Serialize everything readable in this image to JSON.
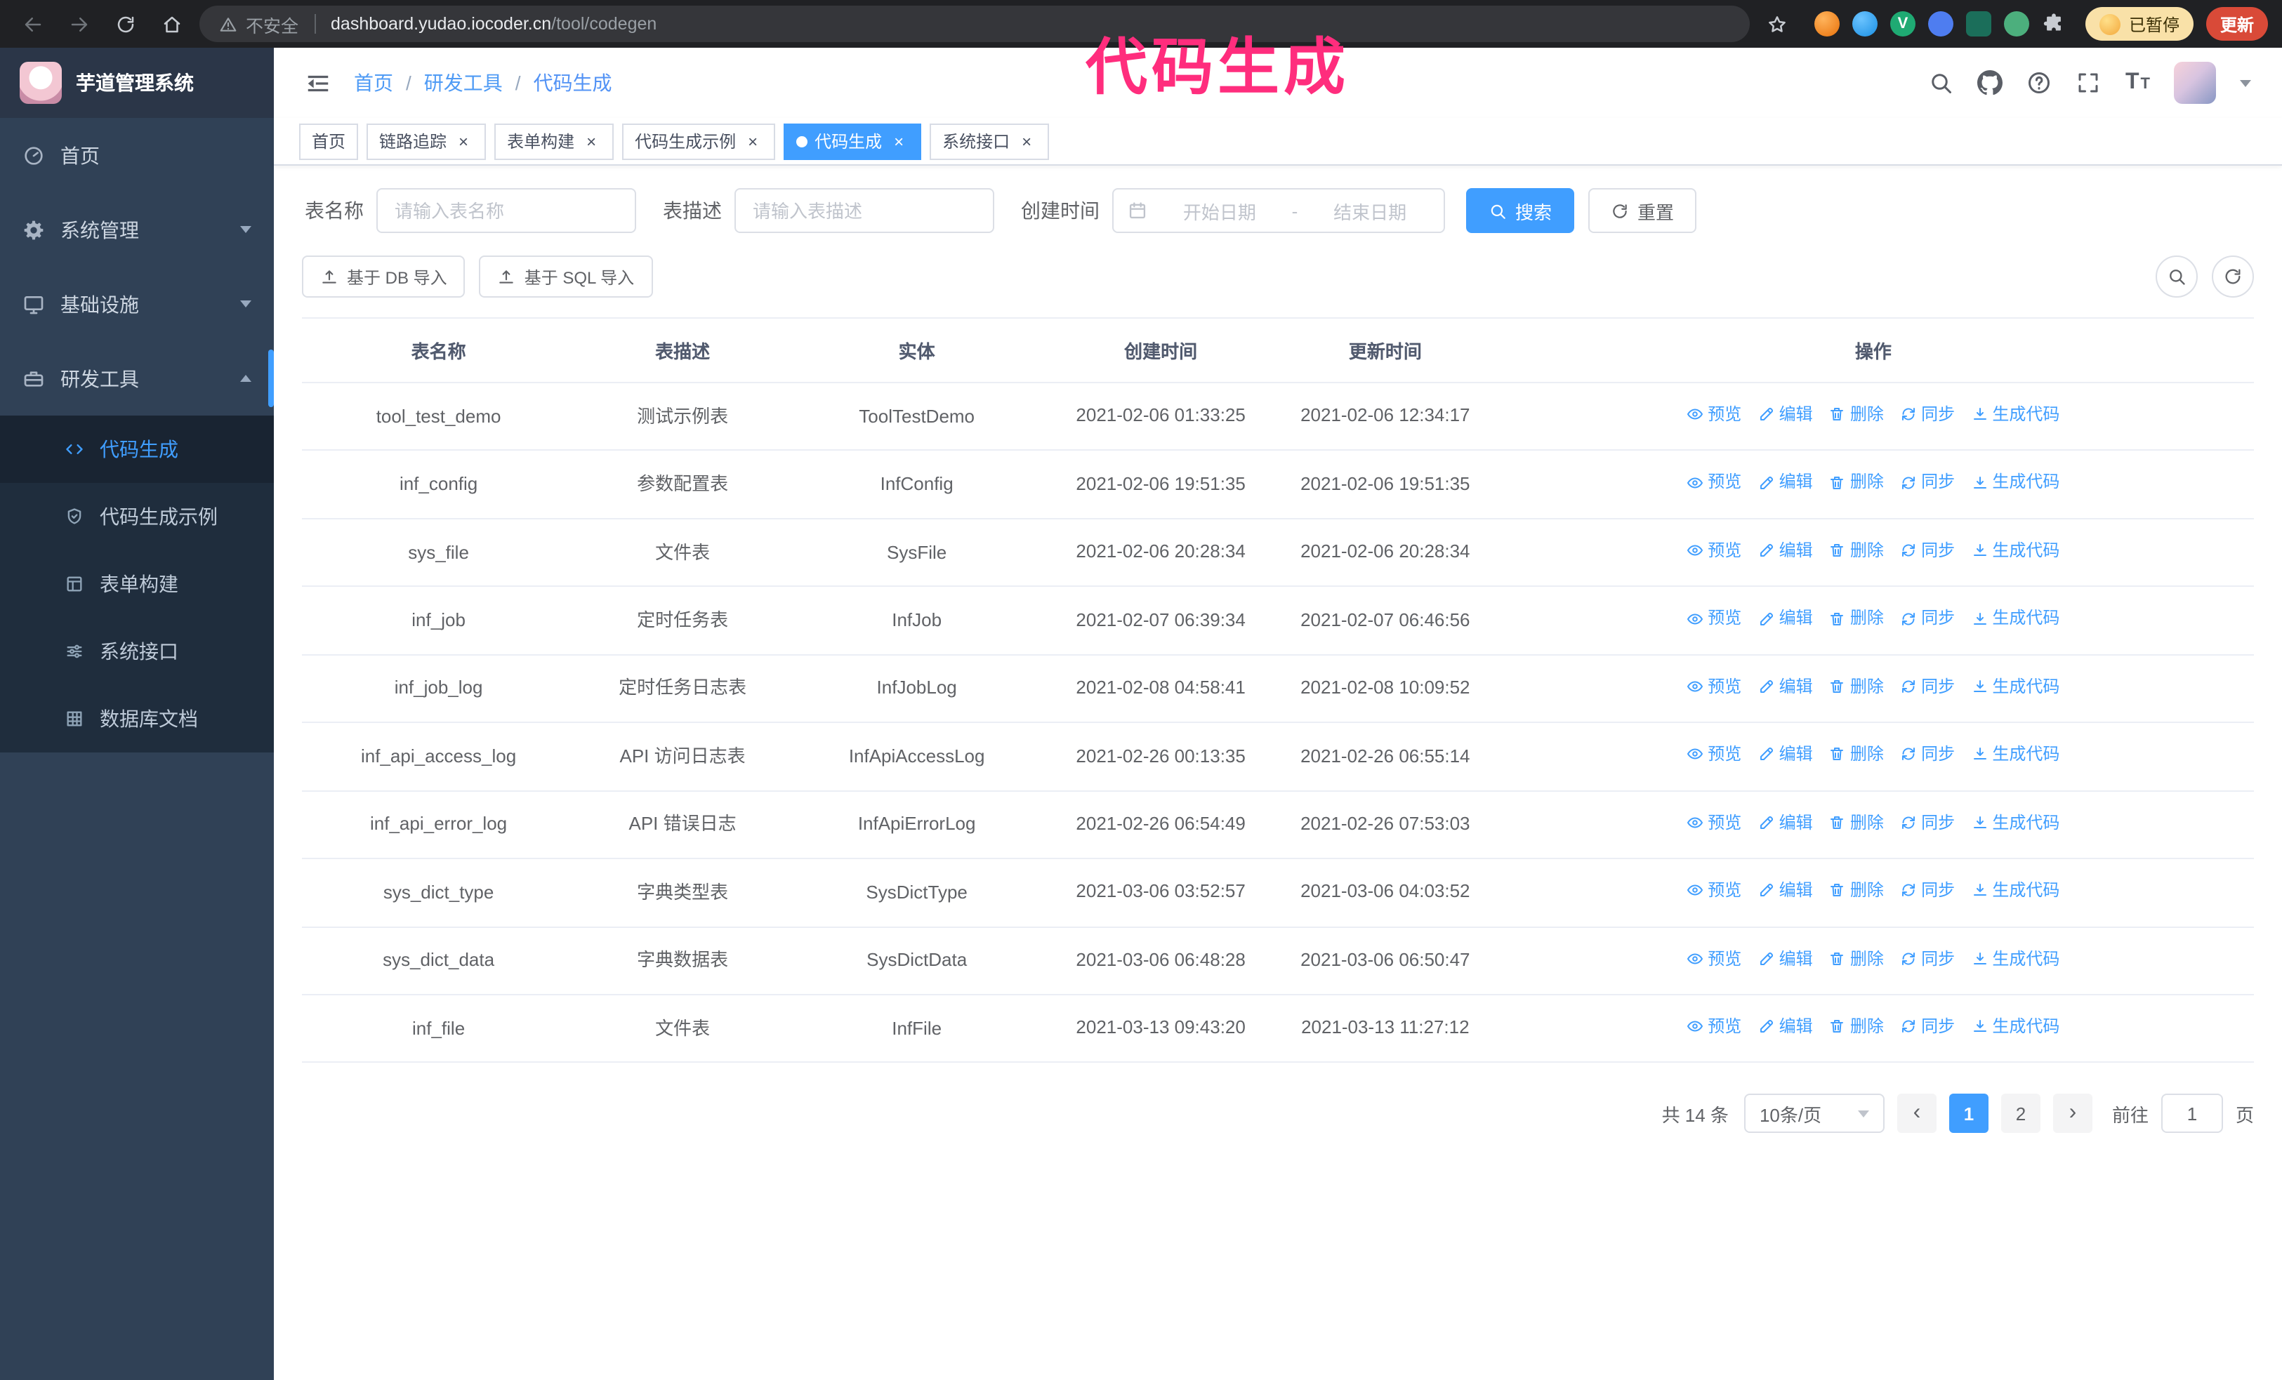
{
  "browser": {
    "security_label": "不安全",
    "url_domain": "dashboard.yudao.iocoder.cn",
    "url_path": "/tool/codegen",
    "paused_badge": "已暂停",
    "update_button": "更新"
  },
  "annotation": {
    "text": "代码生成",
    "color": "#ff2d7d"
  },
  "sidebar": {
    "logo_title": "芋道管理系统",
    "items": [
      {
        "label": "首页"
      },
      {
        "label": "系统管理"
      },
      {
        "label": "基础设施"
      },
      {
        "label": "研发工具",
        "expanded": true
      }
    ],
    "sub_items": [
      {
        "label": "代码生成",
        "active": true
      },
      {
        "label": "代码生成示例"
      },
      {
        "label": "表单构建"
      },
      {
        "label": "系统接口"
      },
      {
        "label": "数据库文档"
      }
    ]
  },
  "breadcrumb": [
    "首页",
    "研发工具",
    "代码生成"
  ],
  "tags": [
    {
      "label": "首页",
      "closable": false,
      "active": false
    },
    {
      "label": "链路追踪",
      "closable": true,
      "active": false
    },
    {
      "label": "表单构建",
      "closable": true,
      "active": false
    },
    {
      "label": "代码生成示例",
      "closable": true,
      "active": false
    },
    {
      "label": "代码生成",
      "closable": true,
      "active": true
    },
    {
      "label": "系统接口",
      "closable": true,
      "active": false
    }
  ],
  "filters": {
    "table_name_label": "表名称",
    "table_name_placeholder": "请输入表名称",
    "table_desc_label": "表描述",
    "table_desc_placeholder": "请输入表描述",
    "create_time_label": "创建时间",
    "date_start_placeholder": "开始日期",
    "date_separator": "-",
    "date_end_placeholder": "结束日期",
    "search_button": "搜索",
    "reset_button": "重置"
  },
  "toolbar": {
    "import_db": "基于 DB 导入",
    "import_sql": "基于 SQL 导入"
  },
  "table": {
    "columns": [
      "表名称",
      "表描述",
      "实体",
      "创建时间",
      "更新时间",
      "操作"
    ],
    "actions": {
      "preview": "预览",
      "edit": "编辑",
      "delete": "删除",
      "sync": "同步",
      "generate": "生成代码"
    },
    "rows": [
      {
        "name": "tool_test_demo",
        "desc": "测试示例表",
        "entity": "ToolTestDemo",
        "created": "2021-02-06 01:33:25",
        "updated": "2021-02-06 12:34:17"
      },
      {
        "name": "inf_config",
        "desc": "参数配置表",
        "entity": "InfConfig",
        "created": "2021-02-06 19:51:35",
        "updated": "2021-02-06 19:51:35"
      },
      {
        "name": "sys_file",
        "desc": "文件表",
        "entity": "SysFile",
        "created": "2021-02-06 20:28:34",
        "updated": "2021-02-06 20:28:34"
      },
      {
        "name": "inf_job",
        "desc": "定时任务表",
        "entity": "InfJob",
        "created": "2021-02-07 06:39:34",
        "updated": "2021-02-07 06:46:56"
      },
      {
        "name": "inf_job_log",
        "desc": "定时任务日志表",
        "entity": "InfJobLog",
        "created": "2021-02-08 04:58:41",
        "updated": "2021-02-08 10:09:52"
      },
      {
        "name": "inf_api_access_log",
        "desc": "API 访问日志表",
        "entity": "InfApiAccessLog",
        "created": "2021-02-26 00:13:35",
        "updated": "2021-02-26 06:55:14"
      },
      {
        "name": "inf_api_error_log",
        "desc": "API 错误日志",
        "entity": "InfApiErrorLog",
        "created": "2021-02-26 06:54:49",
        "updated": "2021-02-26 07:53:03"
      },
      {
        "name": "sys_dict_type",
        "desc": "字典类型表",
        "entity": "SysDictType",
        "created": "2021-03-06 03:52:57",
        "updated": "2021-03-06 04:03:52"
      },
      {
        "name": "sys_dict_data",
        "desc": "字典数据表",
        "entity": "SysDictData",
        "created": "2021-03-06 06:48:28",
        "updated": "2021-03-06 06:50:47"
      },
      {
        "name": "inf_file",
        "desc": "文件表",
        "entity": "InfFile",
        "created": "2021-03-13 09:43:20",
        "updated": "2021-03-13 11:27:12"
      }
    ]
  },
  "pagination": {
    "total_label": "共 14 条",
    "page_size": "10条/页",
    "pages": [
      "1",
      "2"
    ],
    "active_page": "1",
    "goto_label": "前往",
    "goto_value": "1",
    "goto_suffix": "页"
  },
  "icons": {
    "browser": [
      "back-icon",
      "forward-icon",
      "reload-icon",
      "home-icon",
      "warning-icon",
      "star-icon",
      "puzzle-icon"
    ],
    "navbar": [
      "collapse-sidebar-icon",
      "search-icon",
      "github-icon",
      "help-icon",
      "fullscreen-icon",
      "font-size-icon",
      "caret-down-icon"
    ],
    "sidebar": [
      "dashboard-icon",
      "gear-icon",
      "monitor-icon",
      "toolbox-icon",
      "code-icon",
      "shield-check-icon",
      "form-grid-icon",
      "sliders-icon",
      "table-grid-icon"
    ],
    "filters": [
      "calendar-icon",
      "search-icon",
      "refresh-icon"
    ],
    "toolbar": [
      "upload-icon"
    ],
    "row_actions": [
      "eye-icon",
      "edit-icon",
      "trash-icon",
      "sync-icon",
      "download-icon"
    ]
  },
  "colors": {
    "accent": "#409eff",
    "sidebar_bg": "#304156",
    "submenu_bg": "#1f2d3d",
    "annotation": "#ff2d7d",
    "update_button_bg": "#d94a38",
    "paused_badge_bg": "#f9e1a8"
  }
}
